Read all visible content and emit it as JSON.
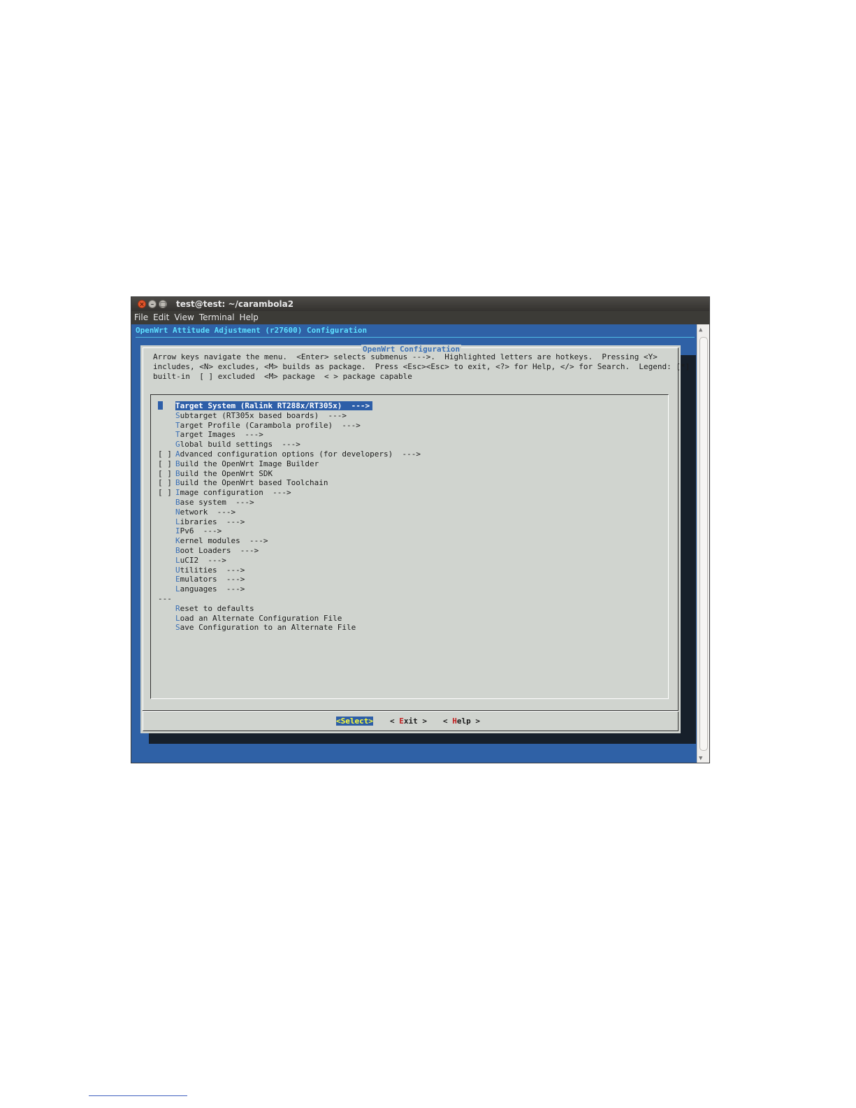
{
  "window": {
    "title": "test@test: ~/carambola2",
    "menu": [
      "File",
      "Edit",
      "View",
      "Terminal",
      "Help"
    ]
  },
  "terminal": {
    "header": "OpenWrt Attitude Adjustment (r27600) Configuration"
  },
  "dialog": {
    "title": "OpenWrt Configuration",
    "help_lines": [
      "Arrow keys navigate the menu.  <Enter> selects submenus --->.  Highlighted letters are hotkeys.  Pressing <Y>",
      "includes, <N> excludes, <M> builds as package.  Press <Esc><Esc> to exit, <?> for Help, </> for Search.  Legend: [*]",
      "built-in  [ ] excluded  <M> package  < > package capable"
    ],
    "items": [
      {
        "prefix": "",
        "hotkey": "T",
        "rest": "arget System (Ralink RT288x/RT305x)  --->",
        "selected": true
      },
      {
        "prefix": "",
        "hotkey": "S",
        "rest": "ubtarget (RT305x based boards)  --->"
      },
      {
        "prefix": "",
        "hotkey": "T",
        "rest": "arget Profile (Carambola profile)  --->"
      },
      {
        "prefix": "",
        "hotkey": "T",
        "rest": "arget Images  --->"
      },
      {
        "prefix": "",
        "hotkey": "G",
        "rest": "lobal build settings  --->"
      },
      {
        "prefix": "[ ]",
        "hotkey": "A",
        "rest": "dvanced configuration options (for developers)  --->"
      },
      {
        "prefix": "[ ]",
        "hotkey": "B",
        "rest": "uild the OpenWrt Image Builder"
      },
      {
        "prefix": "[ ]",
        "hotkey": "B",
        "rest": "uild the OpenWrt SDK"
      },
      {
        "prefix": "[ ]",
        "hotkey": "B",
        "rest": "uild the OpenWrt based Toolchain"
      },
      {
        "prefix": "[ ]",
        "hotkey": "I",
        "rest": "mage configuration  --->"
      },
      {
        "prefix": "",
        "hotkey": "B",
        "rest": "ase system  --->"
      },
      {
        "prefix": "",
        "hotkey": "N",
        "rest": "etwork  --->"
      },
      {
        "prefix": "",
        "hotkey": "L",
        "rest": "ibraries  --->"
      },
      {
        "prefix": "",
        "hotkey": "I",
        "rest": "Pv6  --->"
      },
      {
        "prefix": "",
        "hotkey": "K",
        "rest": "ernel modules  --->"
      },
      {
        "prefix": "",
        "hotkey": "B",
        "rest": "oot Loaders  --->"
      },
      {
        "prefix": "",
        "hotkey": "L",
        "rest": "uCI2  --->"
      },
      {
        "prefix": "",
        "hotkey": "U",
        "rest": "tilities  --->"
      },
      {
        "prefix": "",
        "hotkey": "E",
        "rest": "mulators  --->"
      },
      {
        "prefix": "",
        "hotkey": "L",
        "rest": "anguages  --->"
      },
      {
        "prefix": "---",
        "hotkey": "",
        "rest": "",
        "separator": true
      },
      {
        "prefix": "",
        "hotkey": "R",
        "rest": "eset to defaults"
      },
      {
        "prefix": "",
        "hotkey": "L",
        "rest": "oad an Alternate Configuration File"
      },
      {
        "prefix": "",
        "hotkey": "S",
        "rest": "ave Configuration to an Alternate File"
      }
    ],
    "buttons": {
      "select": "<Select>",
      "exit_pre": "< ",
      "exit_hotkey": "E",
      "exit_rest": "xit >",
      "help_pre": "< ",
      "help_hotkey": "H",
      "help_rest": "elp >"
    }
  },
  "colors": {
    "terminal_bg": "#2f61a6",
    "dialog_bg": "#d0d4cf",
    "hotkey": "#3a6fb5",
    "selection": "#2d5ea8"
  }
}
